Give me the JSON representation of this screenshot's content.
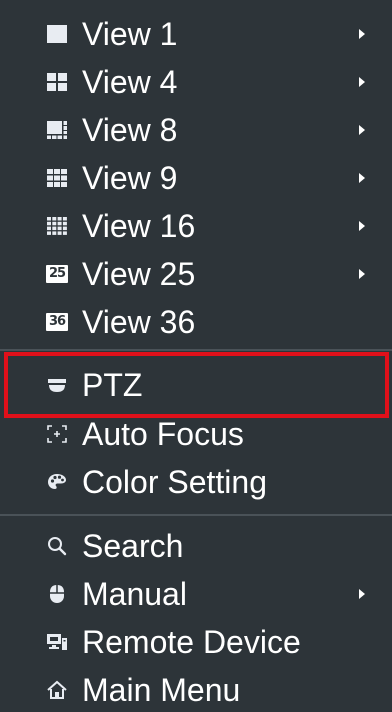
{
  "menu": {
    "items": [
      {
        "label": "View 1",
        "icon": "view-1-icon",
        "submenu": true
      },
      {
        "label": "View 4",
        "icon": "view-4-icon",
        "submenu": true
      },
      {
        "label": "View 8",
        "icon": "view-8-icon",
        "submenu": true
      },
      {
        "label": "View 9",
        "icon": "view-9-icon",
        "submenu": true
      },
      {
        "label": "View 16",
        "icon": "view-16-icon",
        "submenu": true
      },
      {
        "label": "View 25",
        "icon": "view-25-icon",
        "submenu": true
      },
      {
        "label": "View 36",
        "icon": "view-36-icon",
        "submenu": false
      },
      {
        "label": "PTZ",
        "icon": "ptz-camera-icon",
        "submenu": false
      },
      {
        "label": "Auto Focus",
        "icon": "auto-focus-icon",
        "submenu": false
      },
      {
        "label": "Color Setting",
        "icon": "palette-icon",
        "submenu": false
      },
      {
        "label": "Search",
        "icon": "search-icon",
        "submenu": false
      },
      {
        "label": "Manual",
        "icon": "mouse-icon",
        "submenu": true
      },
      {
        "label": "Remote Device",
        "icon": "remote-device-icon",
        "submenu": false
      },
      {
        "label": "Main Menu",
        "icon": "home-icon",
        "submenu": false
      }
    ],
    "icon_numbers": {
      "view25": "25",
      "view36": "36"
    },
    "highlighted_item": "PTZ",
    "colors": {
      "background": "#2d3439",
      "text": "#ffffff",
      "highlight_border": "#e0101a",
      "separator": "#4a5258"
    }
  }
}
